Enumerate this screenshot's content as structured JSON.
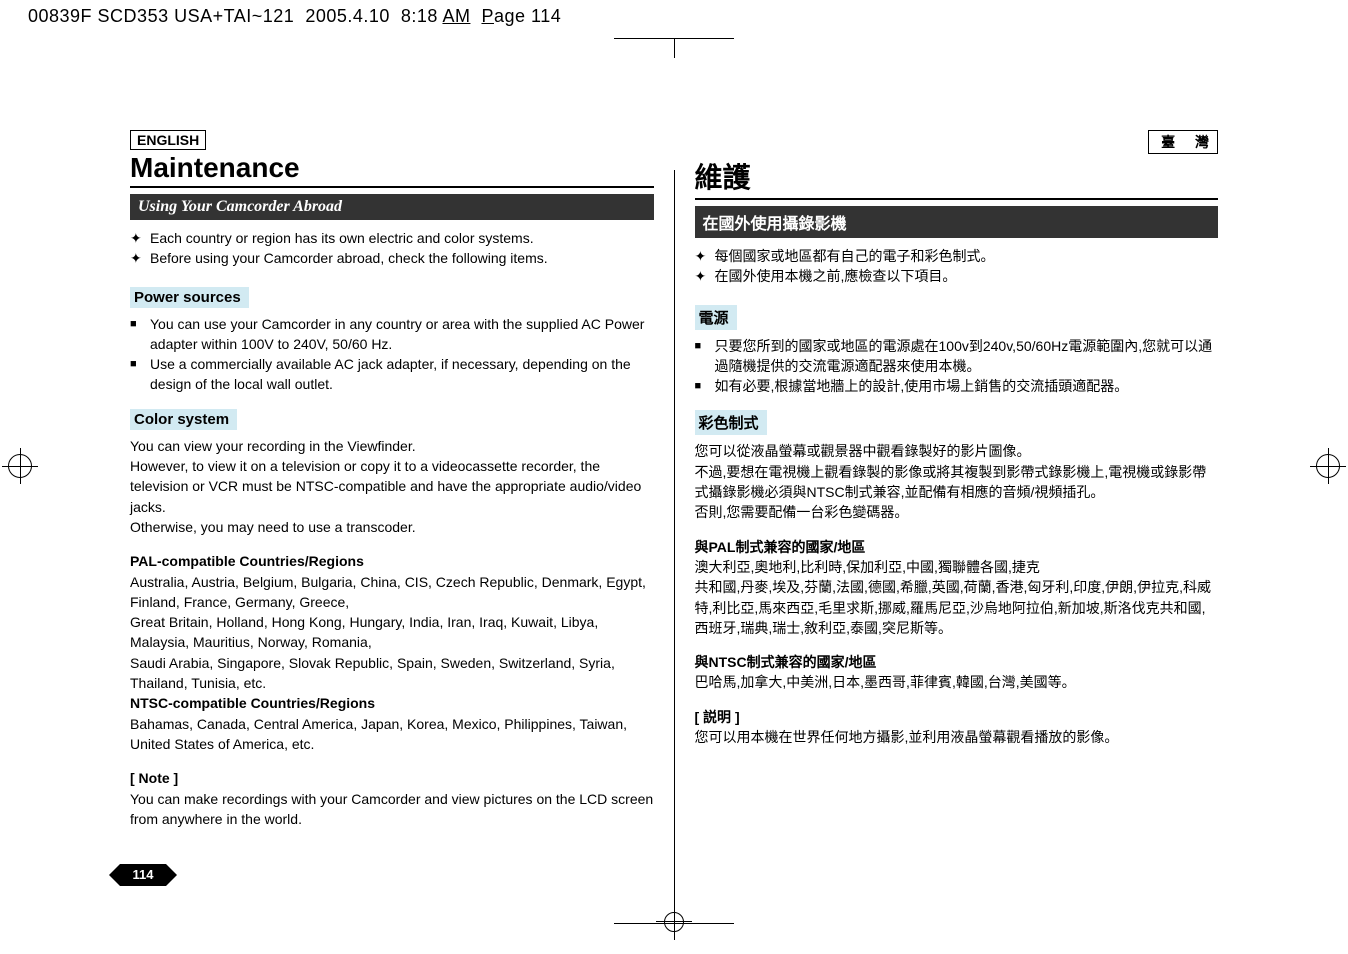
{
  "header": "00839F SCD353 USA+TAI~121  2005.4.10  8:18 AM  Page 114",
  "page_number": "114",
  "left": {
    "lang": "ENGLISH",
    "title": "Maintenance",
    "subtitle": "Using Your Camcorder Abroad",
    "intro": [
      "Each country or region has its own electric and color systems.",
      "Before using your Camcorder abroad, check the following items."
    ],
    "power_head": "Power sources",
    "power_items": [
      "You can use your Camcorder in any country or area with the supplied AC Power adapter within 100V to 240V, 50/60 Hz.",
      "Use a commercially available AC jack adapter, if necessary, depending on the design of the local wall outlet."
    ],
    "color_head": "Color system",
    "color_para": "You can view your recording in the Viewfinder.\nHowever, to view it on a television or copy it to a videocassette recorder, the television or VCR must be NTSC-compatible and have the appropriate audio/video jacks.\nOtherwise, you may need to use a transcoder.",
    "pal_head": "PAL-compatible Countries/Regions",
    "pal_body": "Australia, Austria, Belgium, Bulgaria, China, CIS, Czech Republic, Denmark, Egypt, Finland, France, Germany, Greece,\nGreat Britain, Holland, Hong Kong, Hungary, India, Iran, Iraq, Kuwait, Libya, Malaysia, Mauritius, Norway, Romania,\nSaudi Arabia, Singapore, Slovak Republic, Spain, Sweden, Switzerland, Syria, Thailand, Tunisia, etc.",
    "ntsc_head": "NTSC-compatible Countries/Regions",
    "ntsc_body": "Bahamas, Canada, Central America, Japan, Korea, Mexico, Philippines, Taiwan, United States of America, etc.",
    "note_head": "[ Note ]",
    "note_body": "You can make recordings with your Camcorder and view pictures on the LCD screen from anywhere in the world."
  },
  "right": {
    "lang": "臺 灣",
    "title": "維護",
    "subtitle": "在國外使用攝錄影機",
    "intro": [
      "每個國家或地區都有自己的電子和彩色制式。",
      "在國外使用本機之前,應檢查以下項目。"
    ],
    "power_head": "電源",
    "power_items": [
      "只要您所到的國家或地區的電源處在100v到240v,50/60Hz電源範圍內,您就可以通過隨機提供的交流電源適配器來使用本機。",
      "如有必要,根據當地牆上的設計,使用市場上銷售的交流插頭適配器。"
    ],
    "color_head": "彩色制式",
    "color_para": "您可以從液晶螢幕或觀景器中觀看錄製好的影片圖像。\n不過,要想在電視機上觀看錄製的影像或將其複製到影帶式錄影機上,電視機或錄影帶式攝錄影機必須與NTSC制式兼容,並配備有相應的音頻/視頻插孔。\n否則,您需要配備一台彩色變碼器。",
    "pal_head": "與PAL制式兼容的國家/地區",
    "pal_body": "澳大利亞,奧地利,比利時,保加利亞,中國,獨聯體各國,捷克\n共和國,丹麥,埃及,芬蘭,法國,德國,希臘,英國,荷蘭,香港,匈牙利,印度,伊朗,伊拉克,科威特,利比亞,馬來西亞,毛里求斯,挪威,羅馬尼亞,沙烏地阿拉伯,新加坡,斯洛伐克共和國,西班牙,瑞典,瑞士,敘利亞,泰國,突尼斯等。",
    "ntsc_head": "與NTSC制式兼容的國家/地區",
    "ntsc_body": "巴哈馬,加拿大,中美洲,日本,墨西哥,菲律賓,韓國,台灣,美國等。",
    "note_head": "[ 説明 ]",
    "note_body": "您可以用本機在世界任何地方攝影,並利用液晶螢幕觀看播放的影像。"
  }
}
